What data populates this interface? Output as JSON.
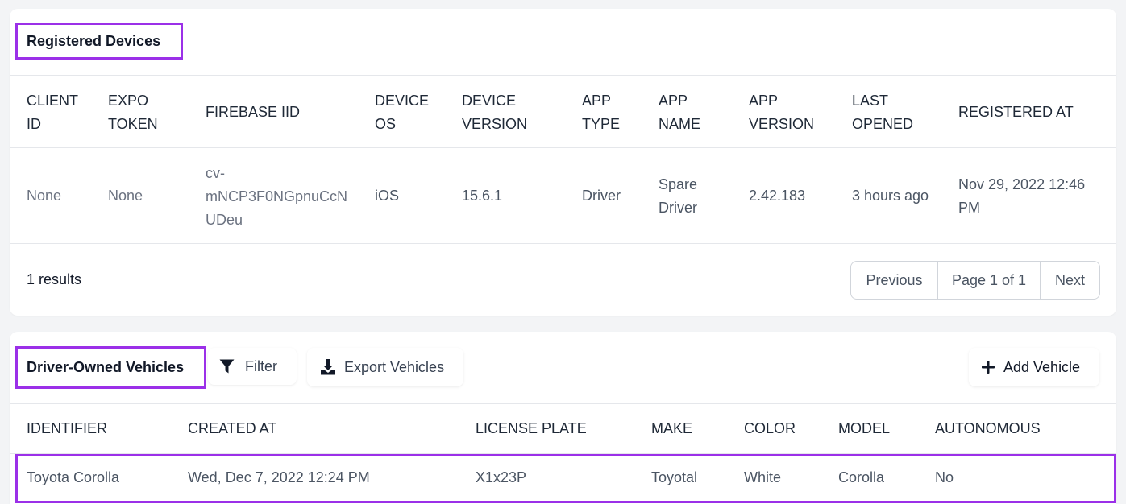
{
  "devices": {
    "title": "Registered Devices",
    "columns": [
      [
        "CLIENT",
        "ID"
      ],
      [
        "EXPO",
        "TOKEN"
      ],
      [
        "FIREBASE IID"
      ],
      [
        "DEVICE",
        "OS"
      ],
      [
        "DEVICE",
        "VERSION"
      ],
      [
        "APP",
        "TYPE"
      ],
      [
        "APP",
        "NAME"
      ],
      [
        "APP",
        "VERSION"
      ],
      [
        "LAST",
        "OPENED"
      ],
      [
        "REGISTERED AT"
      ]
    ],
    "rows": [
      {
        "client_id": "None",
        "expo_token": "None",
        "firebase_iid": [
          "cv-",
          "mNCP3F0NGpnuCcN",
          "UDeu"
        ],
        "device_os": "iOS",
        "device_version": "15.6.1",
        "app_type": "Driver",
        "app_name": [
          "Spare",
          "Driver"
        ],
        "app_version": "2.42.183",
        "last_opened": "3 hours ago",
        "registered_at": [
          "Nov 29, 2022 12:46",
          "PM"
        ]
      }
    ],
    "results": "1 results",
    "pagination": {
      "previous": "Previous",
      "page": "Page 1 of 1",
      "next": "Next"
    }
  },
  "vehicles": {
    "title": "Driver-Owned Vehicles",
    "filter_label": "Filter",
    "export_label": "Export Vehicles",
    "add_label": "Add Vehicle",
    "columns": [
      "IDENTIFIER",
      "CREATED AT",
      "LICENSE PLATE",
      "MAKE",
      "COLOR",
      "MODEL",
      "AUTONOMOUS"
    ],
    "rows": [
      {
        "identifier": "Toyota Corolla",
        "created_at": "Wed, Dec 7, 2022 12:24 PM",
        "license_plate": "X1x23P",
        "make": "Toyotal",
        "color": "White",
        "model": "Corolla",
        "autonomous": "No"
      }
    ]
  },
  "icons": {
    "filter": "filter-icon",
    "export": "download-icon",
    "add": "plus-icon"
  },
  "colors": {
    "highlight": "#9b30e8",
    "background": "#f3f4f6",
    "card": "#ffffff",
    "muted_text": "#6b7280"
  }
}
